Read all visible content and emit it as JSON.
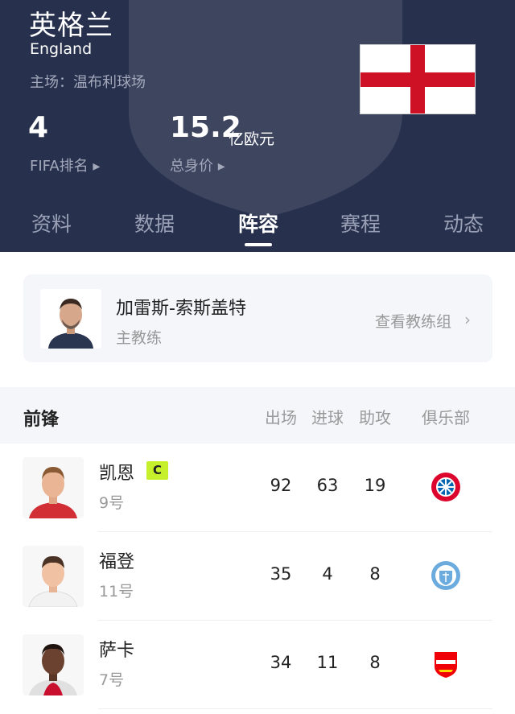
{
  "header": {
    "team_name": "英格兰",
    "team_name_en": "England",
    "stadium": "主场：温布利球场",
    "fifa_rank": "4",
    "fifa_rank_label": "FIFA排名 ▸",
    "total_value": "15.2",
    "total_value_unit": "亿欧元",
    "total_value_label": "总身价 ▸",
    "flag_icon": "england-flag-icon",
    "bg_color": "#27304d"
  },
  "tabs": [
    {
      "label": "资料",
      "active": false
    },
    {
      "label": "数据",
      "active": false
    },
    {
      "label": "阵容",
      "active": true
    },
    {
      "label": "赛程",
      "active": false
    },
    {
      "label": "动态",
      "active": false
    }
  ],
  "coach": {
    "name": "加雷斯-索斯盖特",
    "role": "主教练",
    "link_label": "查看教练组",
    "chevron": "›"
  },
  "squad_section": {
    "title": "前锋",
    "columns": [
      "出场",
      "进球",
      "助攻",
      "俱乐部"
    ]
  },
  "players": [
    {
      "name": "凯恩",
      "number": "9号",
      "captain": "C",
      "appearances": "92",
      "goals": "63",
      "assists": "19",
      "club_icon": "bayern-munich-logo-icon"
    },
    {
      "name": "福登",
      "number": "11号",
      "appearances": "35",
      "goals": "4",
      "assists": "8",
      "club_icon": "manchester-city-logo-icon"
    },
    {
      "name": "萨卡",
      "number": "7号",
      "appearances": "34",
      "goals": "11",
      "assists": "8",
      "club_icon": "arsenal-logo-icon"
    }
  ],
  "colors": {
    "accent_captain": "#c6f02b",
    "flag_red": "#ce1124"
  }
}
